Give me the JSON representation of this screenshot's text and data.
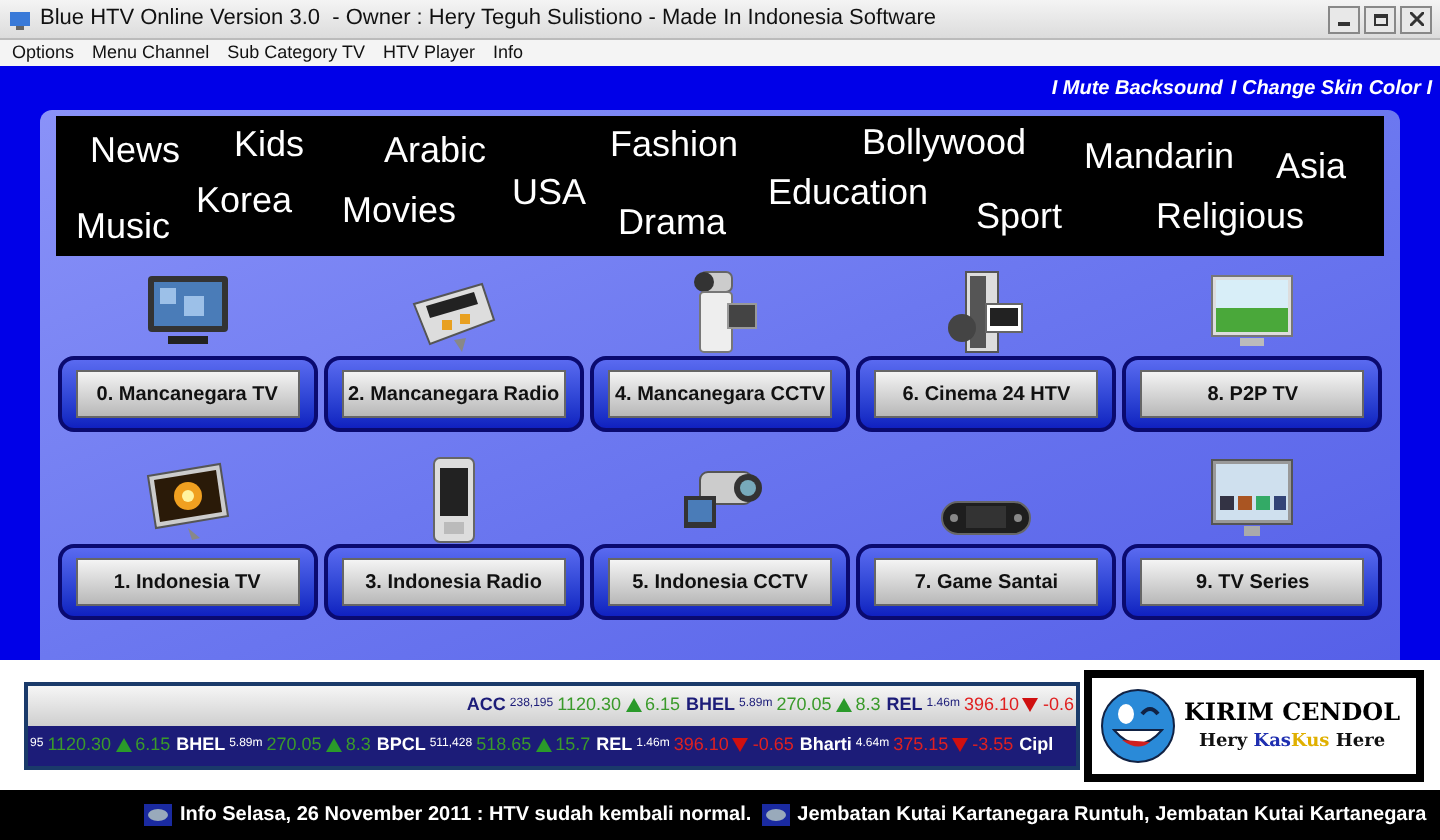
{
  "window": {
    "title": "Blue HTV Online Version 3.0  - Owner : Hery Teguh Sulistiono - Made In Indonesia Software"
  },
  "menu": [
    "Options",
    "Menu Channel",
    "Sub Category TV",
    "HTV Player",
    "Info"
  ],
  "top_links": [
    "I Mute Backsound",
    "I Change Skin Color I"
  ],
  "categories": [
    "News",
    "Kids",
    "Arabic",
    "Fashion",
    "Bollywood",
    "Mandarin",
    "Asia",
    "Music",
    "Korea",
    "Movies",
    "USA",
    "Drama",
    "Education",
    "Sport",
    "Religious"
  ],
  "tiles": [
    "0. Mancanegara TV",
    "2. Mancanegara Radio",
    "4. Mancanegara CCTV",
    "6. Cinema 24 HTV",
    "8. P2P TV",
    "1. Indonesia TV",
    "3. Indonesia Radio",
    "5. Indonesia CCTV",
    "7. Game Santai",
    "9. TV Series"
  ],
  "ticker_rows": [
    {
      "items": [
        {
          "name": "ACC",
          "volume": "238,195",
          "price": "1120.30",
          "change": "6.15",
          "up": true
        },
        {
          "name": "BHEL",
          "volume": "5.89m",
          "price": "270.05",
          "change": "8.3",
          "up": true
        },
        {
          "name": "REL",
          "volume": "1.46m",
          "price": "396.10",
          "change": "-0.6",
          "up": false
        }
      ]
    },
    {
      "items": [
        {
          "volume": "95",
          "price": "1120.30",
          "change": "6.15",
          "up": true
        },
        {
          "name": "BHEL",
          "volume": "5.89m",
          "price": "270.05",
          "change": "8.3",
          "up": true
        },
        {
          "name": "BPCL",
          "volume": "511,428",
          "price": "518.65",
          "change": "15.7",
          "up": true
        },
        {
          "name": "REL",
          "volume": "1.46m",
          "price": "396.10",
          "change": "-0.65",
          "up": false
        },
        {
          "name": "Bharti",
          "volume": "4.64m",
          "price": "375.15",
          "change": "-3.55",
          "up": false
        },
        {
          "name": "Cipl"
        }
      ]
    }
  ],
  "logo": {
    "title": "KIRIM CENDOL",
    "tagline": [
      {
        "text": "Hery ",
        "color": "#111111"
      },
      {
        "text": "Kas",
        "color": "#1f2fb0"
      },
      {
        "text": "Kus",
        "color": "#e0b000"
      },
      {
        "text": " Here",
        "color": "#111111"
      }
    ]
  },
  "news": [
    "Info Selasa, 26 November 2011 : HTV sudah kembali normal.",
    "Jembatan Kutai Kartanegara Runtuh, Jembatan Kutai Kartanegara"
  ]
}
